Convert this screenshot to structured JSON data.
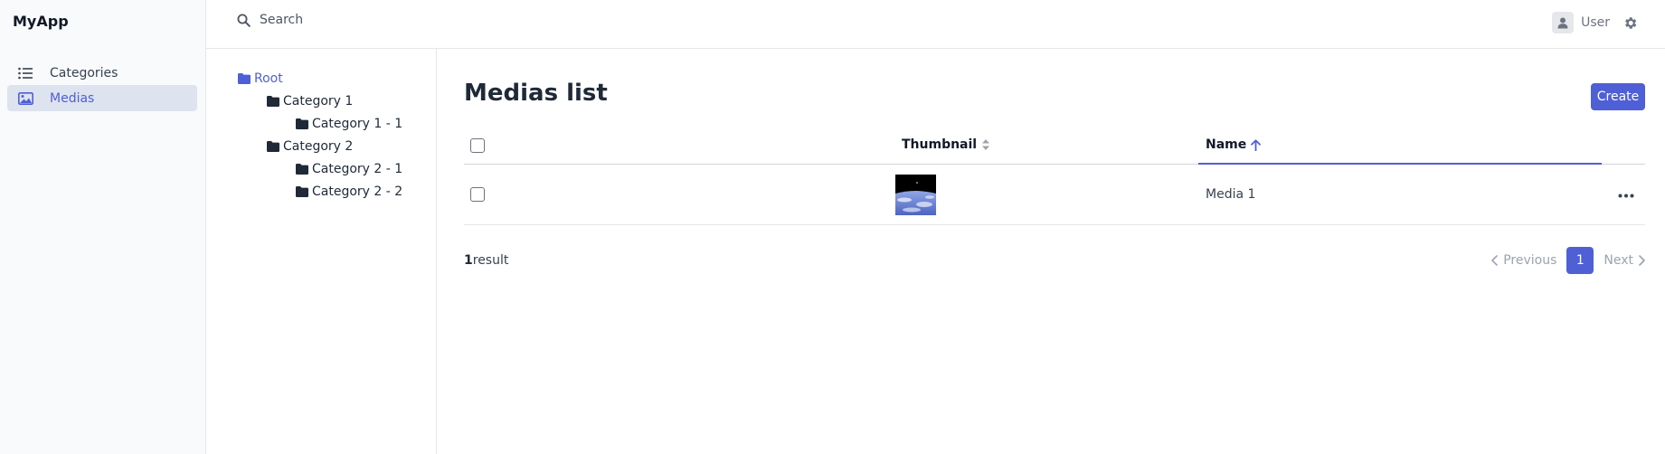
{
  "app": {
    "title": "MyApp"
  },
  "sidebar": {
    "items": [
      {
        "label": "Categories",
        "icon": "list-icon",
        "active": false
      },
      {
        "label": "Medias",
        "icon": "image-icon",
        "active": true
      }
    ]
  },
  "topbar": {
    "search_placeholder": "Search",
    "user_label": "User"
  },
  "tree": {
    "root": "Root",
    "nodes": [
      {
        "label": "Category 1",
        "children": [
          "Category 1 - 1"
        ]
      },
      {
        "label": "Category 2",
        "children": [
          "Category 2 - 1",
          "Category 2 - 2"
        ]
      }
    ]
  },
  "main": {
    "title": "Medias list",
    "create_label": "Create",
    "columns": {
      "thumbnail": "Thumbnail",
      "name": "Name"
    },
    "rows": [
      {
        "name": "Media 1",
        "thumbnail": "earth-from-space"
      }
    ],
    "result_count": "1",
    "result_label": "result",
    "pagination": {
      "previous": "Previous",
      "current": "1",
      "next": "Next"
    }
  },
  "colors": {
    "accent": "#4f5fd5",
    "sidebar_bg": "#f8fafc",
    "active_bg": "#dde3ef"
  }
}
